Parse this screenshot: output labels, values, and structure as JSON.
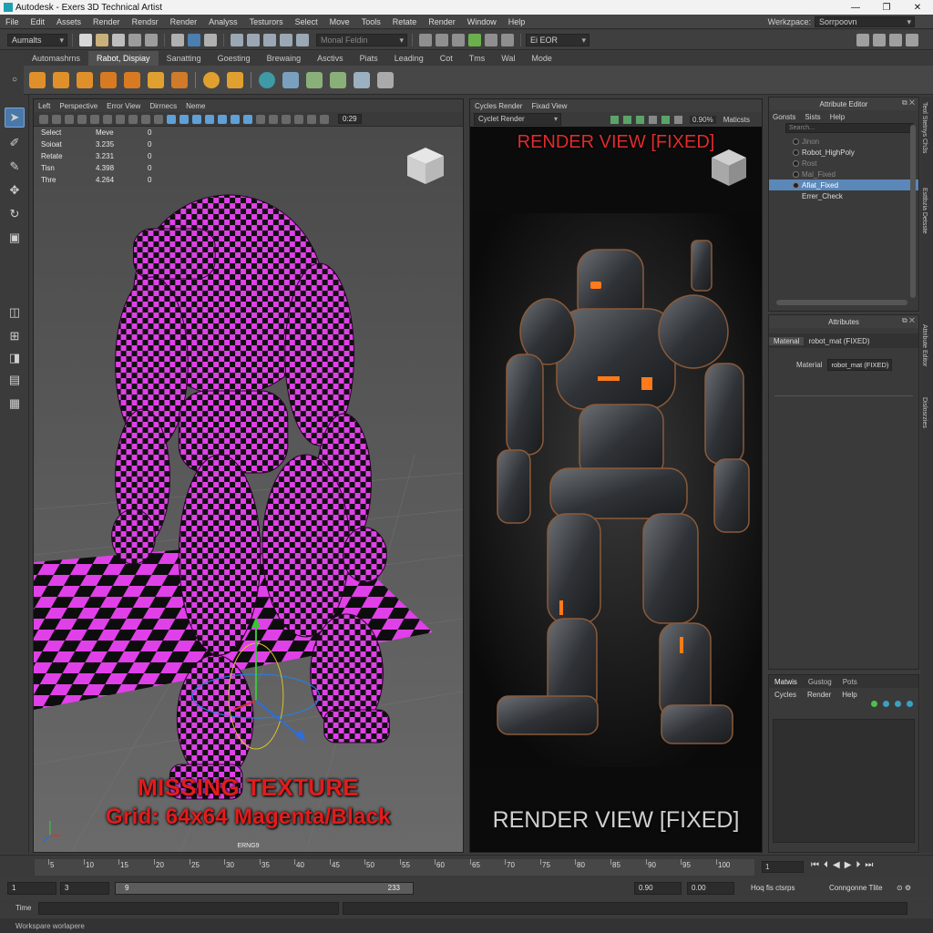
{
  "window": {
    "title": "Autodesk - Exers 3D Technical Artist",
    "controls": [
      "—",
      "❐",
      "✕"
    ]
  },
  "menu": [
    "File",
    "Edit",
    "Assets",
    "Render",
    "Rendsr",
    "Render",
    "Analyss",
    "Testurors",
    "Select",
    "Move",
    "Tools",
    "Retate",
    "Render",
    "Window",
    "Help"
  ],
  "workspace": {
    "label": "Werkzpace:",
    "value": "Sorrpoovn"
  },
  "toolbar": {
    "mode": "Aumalts",
    "field": "Monal Feldin",
    "field2": "Ei EOR"
  },
  "shelf_tabs": [
    "Automashrns",
    "Rabot, Dispiay",
    "Sanatting",
    "Goesting",
    "Brewaing",
    "Asctivs",
    "Piats",
    "Leading",
    "Cot",
    "Tms",
    "Wal",
    "Mode"
  ],
  "shelf_active": 1,
  "viewport_left": {
    "menu": [
      "Left",
      "Perspective",
      "Error View",
      "Dirrnecs",
      "Neme"
    ],
    "frame": "0:29",
    "hud": [
      {
        "k": "Select",
        "a": "Meve",
        "b": "0"
      },
      {
        "k": "Soioat",
        "a": "3.235",
        "b": "0"
      },
      {
        "k": "Retate",
        "a": "3.231",
        "b": "0"
      },
      {
        "k": "Tisn",
        "a": "4.398",
        "b": "0"
      },
      {
        "k": "Thre",
        "a": "4.264",
        "b": "0"
      }
    ],
    "caption_line1": "MISSING TEXTURE",
    "caption_line2": "Grid: 64x64 Magenta/Black",
    "bottom_label": "ERNG9",
    "checker_color": "#e040e8"
  },
  "viewport_right": {
    "menu": [
      "Cycles Render",
      "Fixad View"
    ],
    "renderer": "Cyclet Render",
    "zoom": "0.90%",
    "mode": "Maticsts",
    "top_label": "RENDER VIEW [FIXED]",
    "bottom_label": "RENDER VIEW [FIXED]"
  },
  "attribute_editor": {
    "title": "Attribute Editor",
    "menu": [
      "Gonsts",
      "Sists",
      "Help"
    ],
    "search_placeholder": "Search...",
    "items": [
      {
        "label": "Jinon",
        "state": "dim"
      },
      {
        "label": "Robot_HighPoly",
        "state": "normal"
      },
      {
        "label": "Rost",
        "state": "dim"
      },
      {
        "label": "Mal_Fixed",
        "state": "dim"
      },
      {
        "label": "Afiat_Fixed",
        "state": "sel"
      },
      {
        "label": "Errer_Check",
        "state": "normal"
      }
    ]
  },
  "attributes": {
    "title": "Attributes",
    "tabs": [
      "Matenal",
      "robot_mat (FIXED)"
    ],
    "material_label": "Material",
    "material_value": "robot_mat (FIXED)"
  },
  "material_panel": {
    "tabs": [
      "Matwis",
      "Gustog",
      "Pots"
    ],
    "menu": [
      "Cycles",
      "Render",
      "Help"
    ]
  },
  "side_tabs": [
    "Teol Stetnys",
    "Ch3s",
    "Esttbzia Detsste",
    "Attribute Editor",
    "Dislosrzies"
  ],
  "timeline": {
    "ticks": [
      "5",
      "10",
      "15",
      "20",
      "25",
      "30",
      "35",
      "40",
      "45",
      "50",
      "55",
      "60",
      "65",
      "70",
      "75",
      "80",
      "85",
      "90",
      "95",
      "100"
    ],
    "current": "1",
    "play": [
      "⏮",
      "⏴",
      "◀",
      "▶",
      "⏵",
      "⏭"
    ]
  },
  "range": {
    "start": "1",
    "start2": "3",
    "slider_a": "9",
    "slider_b": "233",
    "end": "0.90",
    "end2": "0.00",
    "label1": "Hoq fis ctsrps",
    "label2": "Conngonne Tlite"
  },
  "command": {
    "label": "Time"
  },
  "status": "Workspare worlapere"
}
